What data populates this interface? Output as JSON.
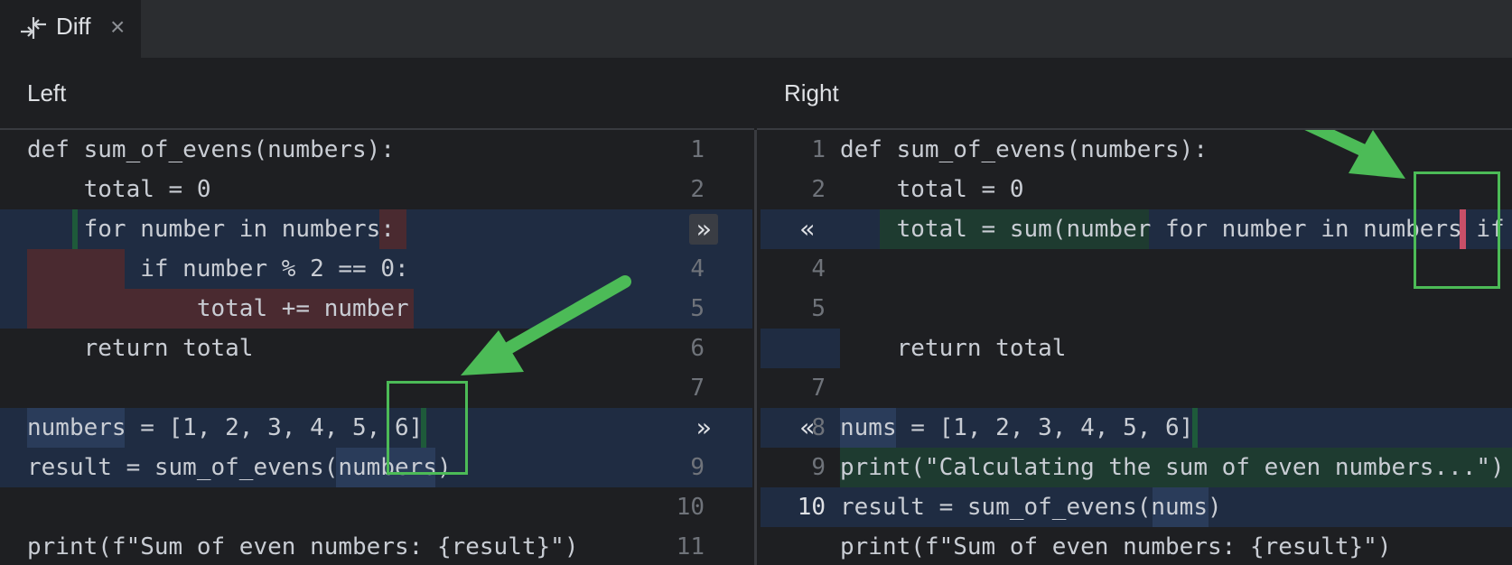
{
  "tab": {
    "icon": "diff-icon",
    "label": "Diff",
    "close": "×"
  },
  "left": {
    "header": "Left",
    "lines": [
      {
        "num": "1",
        "text": "def sum_of_evens(numbers):"
      },
      {
        "num": "2",
        "text": "    total = 0"
      },
      {
        "num": "",
        "text": "    for number in numbers:"
      },
      {
        "num": "4",
        "text": "        if number % 2 == 0:"
      },
      {
        "num": "5",
        "text": "            total += number"
      },
      {
        "num": "6",
        "text": "    return total"
      },
      {
        "num": "7",
        "text": ""
      },
      {
        "num": "",
        "text": "numbers = [1, 2, 3, 4, 5, 6]"
      },
      {
        "num": "9",
        "text": "result = sum_of_evens(numbers)"
      },
      {
        "num": "10",
        "text": ""
      },
      {
        "num": "11",
        "text": "print(f\"Sum of even numbers: {result}\")"
      }
    ]
  },
  "right": {
    "header": "Right",
    "lines": [
      {
        "num": "1",
        "text": "def sum_of_evens(numbers):"
      },
      {
        "num": "2",
        "text": "    total = 0"
      },
      {
        "num": "",
        "text": "    total = sum(number for number in numbers if"
      },
      {
        "num": "4",
        "text": ""
      },
      {
        "num": "5",
        "text": ""
      },
      {
        "num": "",
        "text": "    return total"
      },
      {
        "num": "7",
        "text": ""
      },
      {
        "num": "8",
        "text": "nums = [1, 2, 3, 4, 5, 6]"
      },
      {
        "num": "9",
        "text": "print(\"Calculating the sum of even numbers...\")"
      },
      {
        "num": "10",
        "text": "result = sum_of_evens(nums)"
      },
      {
        "num": "",
        "text": "print(f\"Sum of even numbers: {result}\")"
      }
    ]
  },
  "actions": {
    "apply_right": "»",
    "apply_left": "«"
  },
  "colors": {
    "modified": "#1f2c42",
    "deleted": "#4a2a30",
    "inserted": "#1e3b30",
    "annotation": "#4cbb57"
  }
}
